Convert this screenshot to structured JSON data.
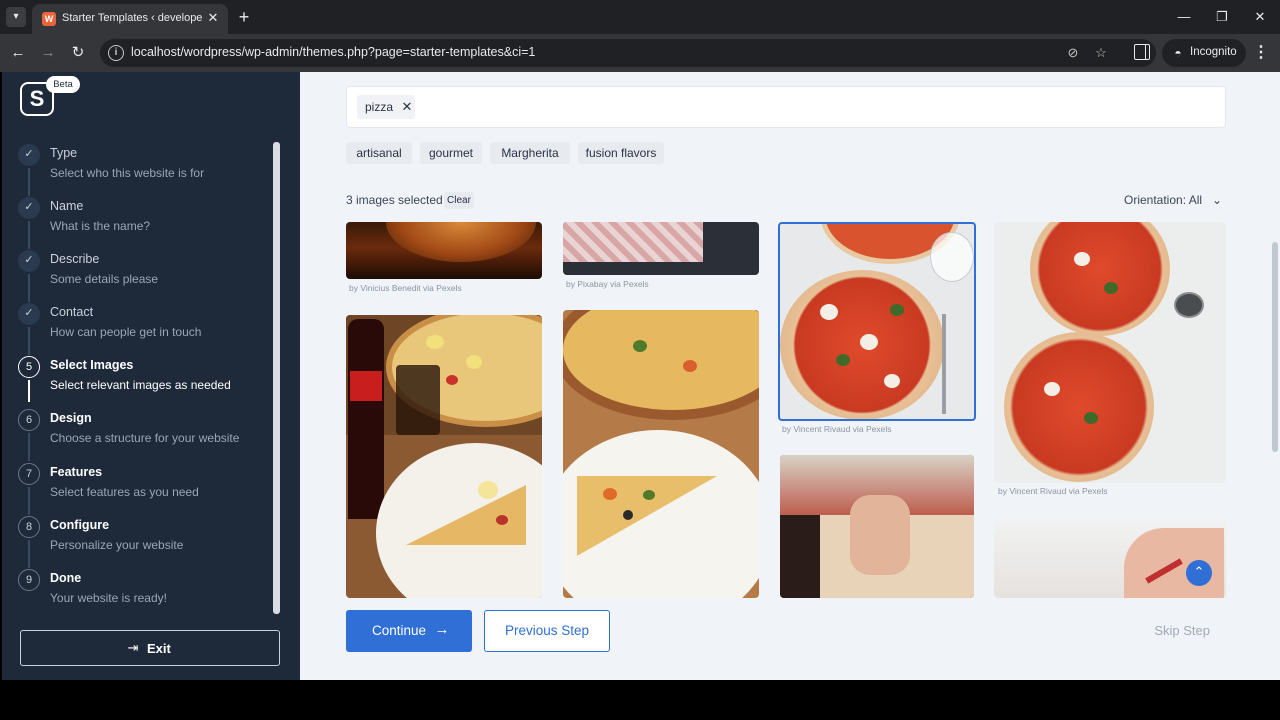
{
  "browser": {
    "tab_title": "Starter Templates ‹ developercr",
    "url": "localhost/wordpress/wp-admin/themes.php?page=starter-templates&ci=1",
    "incognito_label": "Incognito"
  },
  "sidebar": {
    "logo_letter": "S",
    "beta_label": "Beta",
    "steps": [
      {
        "marker": "✓",
        "title": "Type",
        "desc": "Select who this website is for",
        "state": "done"
      },
      {
        "marker": "✓",
        "title": "Name",
        "desc": "What is the name?",
        "state": "done"
      },
      {
        "marker": "✓",
        "title": "Describe",
        "desc": "Some details please",
        "state": "done"
      },
      {
        "marker": "✓",
        "title": "Contact",
        "desc": "How can people get in touch",
        "state": "done"
      },
      {
        "marker": "5",
        "title": "Select Images",
        "desc": "Select relevant images as needed",
        "state": "active"
      },
      {
        "marker": "6",
        "title": "Design",
        "desc": "Choose a structure for your website",
        "state": "pending"
      },
      {
        "marker": "7",
        "title": "Features",
        "desc": "Select features as you need",
        "state": "pending"
      },
      {
        "marker": "8",
        "title": "Configure",
        "desc": "Personalize your website",
        "state": "pending"
      },
      {
        "marker": "9",
        "title": "Done",
        "desc": "Your website is ready!",
        "state": "pending"
      }
    ],
    "exit_label": "Exit"
  },
  "main": {
    "search_tag": "pizza",
    "suggestions": [
      "artisanal",
      "gourmet",
      "Margherita",
      "fusion flavors"
    ],
    "selected_count": "3 images selected",
    "clear_label": "Clear",
    "orientation_label": "Orientation: All",
    "credits": [
      "by Vinicius Benedit via Pexels",
      "by Pixabay via Pexels",
      "by Vincent Rivaud via Pexels",
      "by Vincent Rivaud via Pexels"
    ],
    "continue_label": "Continue",
    "previous_label": "Previous Step",
    "skip_label": "Skip Step"
  },
  "colors": {
    "sidebar_bg": "#1e2a3a",
    "main_bg": "#f0f4f8",
    "accent": "#2f6fd6"
  },
  "icons": [
    "tab-list-icon",
    "wordpress-favicon-icon",
    "close-icon",
    "plus-icon",
    "back-icon",
    "forward-icon",
    "reload-icon",
    "site-info-icon",
    "eye-off-icon",
    "star-icon",
    "side-panel-icon",
    "incognito-icon",
    "more-icon",
    "check-icon",
    "exit-icon",
    "chevron-down-icon",
    "arrow-right-icon",
    "arrow-up-icon"
  ]
}
